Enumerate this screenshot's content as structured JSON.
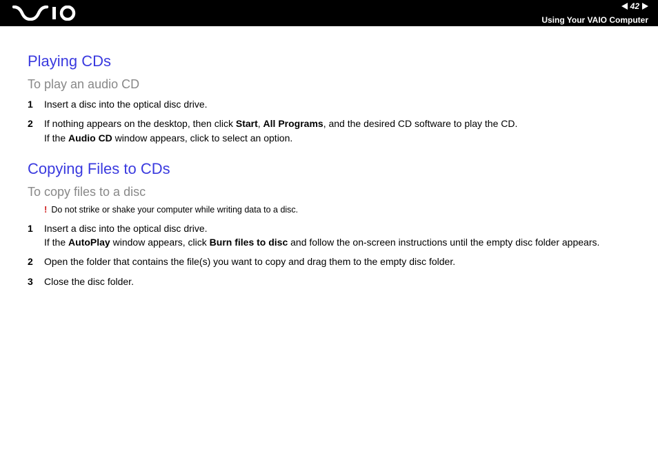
{
  "header": {
    "page_number": "42",
    "breadcrumb": "Using Your VAIO Computer"
  },
  "section1": {
    "title": "Playing CDs",
    "subtitle": "To play an audio CD",
    "steps": {
      "n1": "1",
      "t1": "Insert a disc into the optical disc drive.",
      "n2": "2",
      "t2a": "If nothing appears on the desktop, then click ",
      "t2b_start": "Start",
      "t2b_sep": ", ",
      "t2b_prog": "All Programs",
      "t2b_tail": ", and the desired CD software to play the CD.",
      "t2c_pre": "If the ",
      "t2c_bold": "Audio CD",
      "t2c_post": " window appears, click to select an option."
    }
  },
  "section2": {
    "title": "Copying Files to CDs",
    "subtitle": "To copy files to a disc",
    "warning_icon": "!",
    "warning_text": "Do not strike or shake your computer while writing data to a disc.",
    "steps": {
      "n1": "1",
      "t1a": "Insert a disc into the optical disc drive.",
      "t1b_pre": "If the ",
      "t1b_bold1": "AutoPlay",
      "t1b_mid": " window appears, click ",
      "t1b_bold2": "Burn files to disc",
      "t1b_post": " and follow the on-screen instructions until the empty disc folder appears.",
      "n2": "2",
      "t2": "Open the folder that contains the file(s) you want to copy and drag them to the empty disc folder.",
      "n3": "3",
      "t3": "Close the disc folder."
    }
  }
}
